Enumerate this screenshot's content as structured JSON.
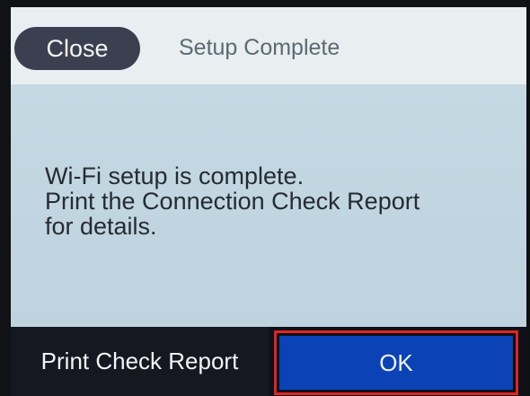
{
  "header": {
    "close_label": "Close",
    "title": "Setup Complete"
  },
  "message": {
    "lines": [
      "Wi-Fi setup is complete.",
      "Print the Connection Check Report",
      "for details."
    ]
  },
  "footer": {
    "print_label": "Print Check Report",
    "ok_label": "OK"
  },
  "colors": {
    "screen_background": "#c2d6e0",
    "header_background": "#e9eef0",
    "close_button": "#3b4050",
    "ok_button": "#0b43b7",
    "highlight_border": "#e0241f",
    "footer_background": "#0e1118"
  }
}
